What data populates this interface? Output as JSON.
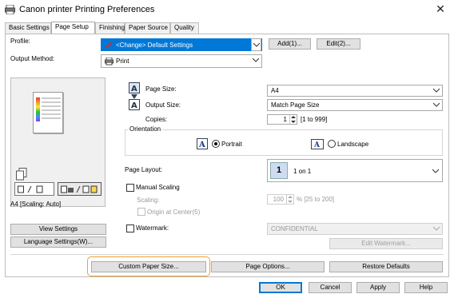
{
  "window": {
    "title": "Canon printer Printing Preferences",
    "close_symbol": "✕"
  },
  "tabs": [
    {
      "label": "Basic Settings",
      "active": false
    },
    {
      "label": "Page Setup",
      "active": true
    },
    {
      "label": "Finishing",
      "active": false
    },
    {
      "label": "Paper Source",
      "active": false
    },
    {
      "label": "Quality",
      "active": false
    }
  ],
  "profile": {
    "label": "Profile:",
    "value": "<Change> Default Settings",
    "add_button": "Add(1)...",
    "edit_button": "Edit(2)..."
  },
  "output_method": {
    "label": "Output Method:",
    "value": "Print"
  },
  "preview": {
    "caption": "A4 [Scaling: Auto]",
    "view_settings_button": "View Settings",
    "language_settings_button": "Language Settings(W)..."
  },
  "page_size": {
    "label": "Page Size:",
    "value": "A4"
  },
  "output_size": {
    "label": "Output Size:",
    "value": "Match Page Size"
  },
  "copies": {
    "label": "Copies:",
    "value": "1",
    "range": "[1 to 999]"
  },
  "orientation": {
    "label": "Orientation",
    "portrait_label": "Portrait",
    "landscape_label": "Landscape",
    "selected": "Portrait"
  },
  "page_layout": {
    "label": "Page Layout:",
    "icon_number": "1",
    "value": "1 on 1"
  },
  "manual_scaling": {
    "label": "Manual Scaling",
    "checked": false,
    "scaling_label": "Scaling:",
    "scaling_value": "100",
    "scaling_range": "% [25 to 200]",
    "origin_label": "Origin at Center(5)"
  },
  "watermark": {
    "label": "Watermark:",
    "checked": false,
    "value": "CONFIDENTIAL",
    "edit_button": "Edit Watermark..."
  },
  "bottom_buttons": {
    "custom_paper_size": "Custom Paper Size...",
    "page_options": "Page Options...",
    "restore_defaults": "Restore Defaults"
  },
  "dialog_buttons": {
    "ok": "OK",
    "cancel": "Cancel",
    "apply": "Apply",
    "help": "Help"
  },
  "colors": {
    "accent": "#0078d7",
    "highlight": "#f0a030",
    "profile_icon": "#d9281e"
  }
}
